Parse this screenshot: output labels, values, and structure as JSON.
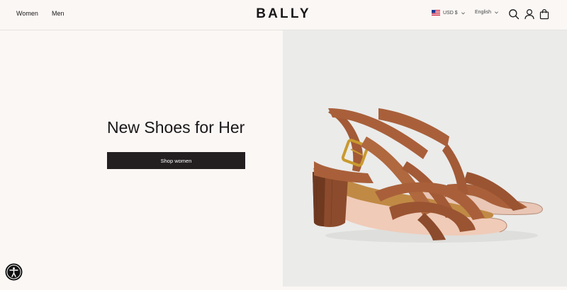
{
  "header": {
    "nav": [
      {
        "label": "Women"
      },
      {
        "label": "Men"
      }
    ],
    "logo": "BALLY",
    "currency": {
      "label": "USD $",
      "flag": "us-flag-icon"
    },
    "language": {
      "label": "English"
    },
    "icons": [
      "search-icon",
      "user-icon",
      "shopping-bag-icon"
    ]
  },
  "hero": {
    "headline": "New Shoes for Her",
    "cta_label": "Shop women",
    "image": "tan-leather-block-heel-sandals"
  },
  "accessibility": {
    "icon": "accessibility-icon"
  },
  "colors": {
    "background": "#faf7f5",
    "image_background": "#ebebea",
    "button": "#231f20",
    "button_text": "#ffffff",
    "text": "#1a1718",
    "leather": "#a9603a"
  }
}
